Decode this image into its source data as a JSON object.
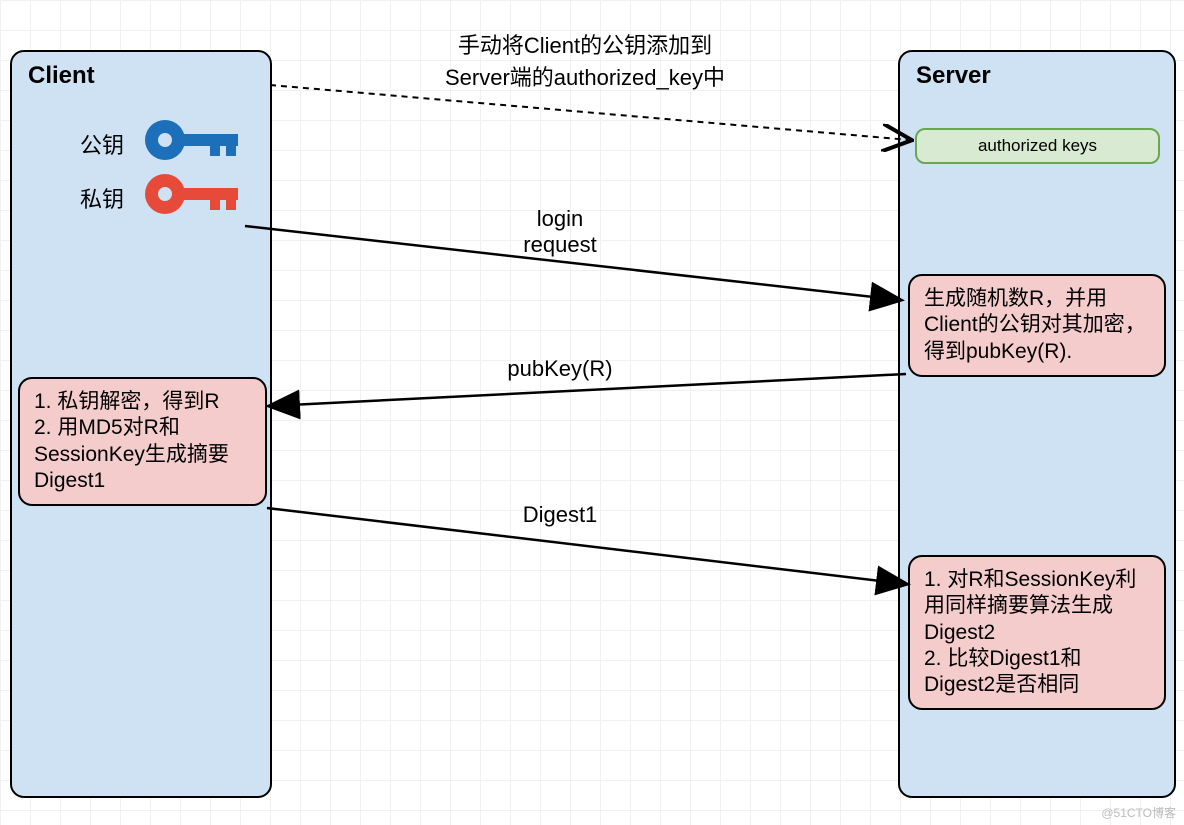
{
  "client": {
    "title": "Client",
    "pubkey_label": "公钥",
    "privkey_label": "私钥",
    "step_box": "1. 私钥解密，得到R\n2. 用MD5对R和SessionKey生成摘要Digest1"
  },
  "server": {
    "title": "Server",
    "authorized_keys": "authorized keys",
    "step_box1": "生成随机数R，并用Client的公钥对其加密，得到pubKey(R).",
    "step_box2": "1. 对R和SessionKey利用同样摘要算法生成Digest2\n2. 比较Digest1和Digest2是否相同"
  },
  "arrows": {
    "manual_add": "手动将Client的公钥添加到\nServer端的authorized_key中",
    "login": "login\nrequest",
    "pubkey_r": "pubKey(R)",
    "digest1": "Digest1"
  },
  "colors": {
    "blue_box": "#cfe2f3",
    "pink_box": "#f4cccc",
    "green_box": "#d9ead3",
    "pub_key": "#1c6fb8",
    "priv_key": "#e84a3a"
  },
  "watermark": "@51CTO博客"
}
